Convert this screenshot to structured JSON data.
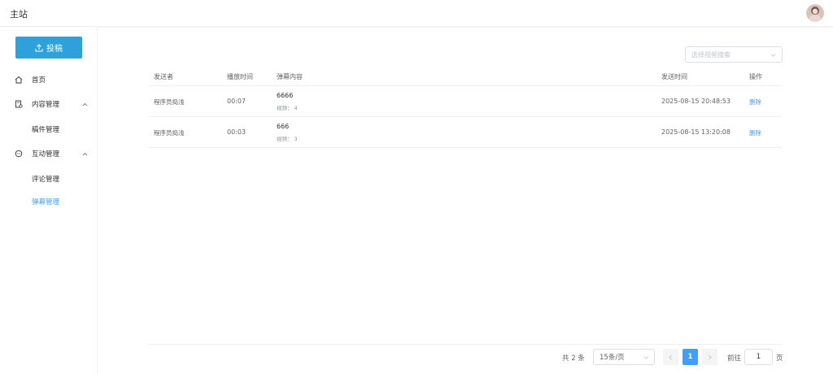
{
  "header": {
    "title": "主站"
  },
  "sidebar": {
    "upload_label": "投稿",
    "items": [
      {
        "label": "首页",
        "icon": "home-icon"
      },
      {
        "label": "内容管理",
        "icon": "document-icon"
      },
      {
        "label": "稿件管理"
      },
      {
        "label": "互动管理",
        "icon": "chat-icon"
      },
      {
        "label": "评论管理"
      },
      {
        "label": "弹幕管理"
      }
    ]
  },
  "filter": {
    "placeholder": "选择视频搜索"
  },
  "table": {
    "headers": [
      "发送者",
      "播放时间",
      "弹幕内容",
      "发送时间",
      "操作"
    ],
    "video_prefix": "视频：",
    "rows": [
      {
        "sender": "程序员捣浅",
        "time": "00:07",
        "content": "6666",
        "video": "4",
        "sent": "2025-08-15 20:48:53",
        "action": "删除"
      },
      {
        "sender": "程序员捣浅",
        "time": "00:03",
        "content": "666",
        "video": "3",
        "sent": "2025-08-15 13:20:08",
        "action": "删除"
      }
    ]
  },
  "pagination": {
    "total": "共 2 条",
    "page_size": "15条/页",
    "current_page": "1",
    "goto_label": "前往",
    "goto_value": "1",
    "goto_suffix": "页"
  },
  "colors": {
    "primary_button": "#2ea1db",
    "link": "#409eff"
  }
}
